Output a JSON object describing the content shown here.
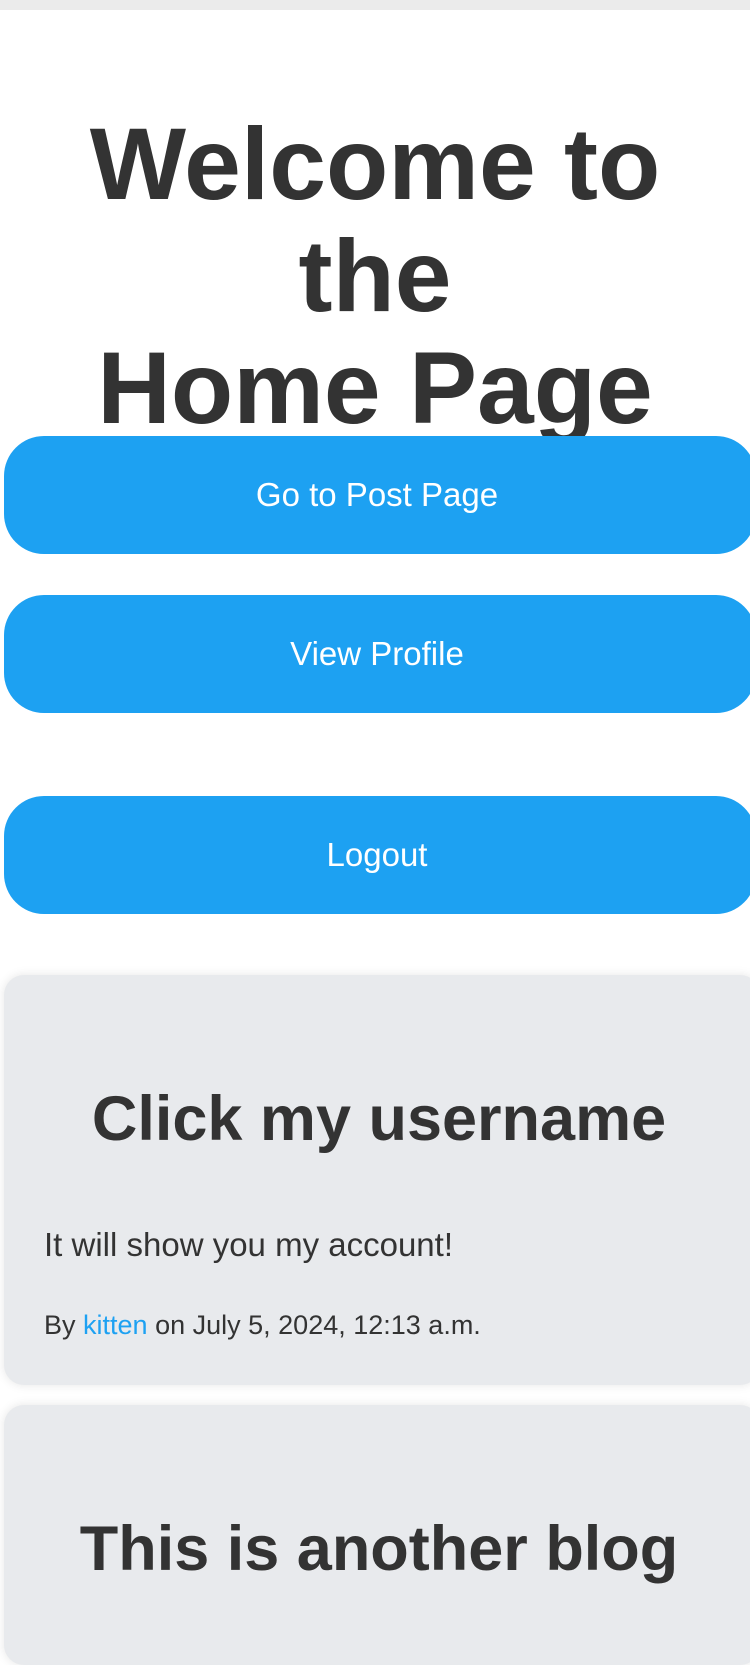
{
  "header": {
    "title_line1": "Welcome to the",
    "title_line2": "Home Page"
  },
  "actions": {
    "post_page": "Go to Post Page",
    "view_profile": "View Profile",
    "logout": "Logout"
  },
  "posts": [
    {
      "title": "Click my username",
      "body": "It will show you my account!",
      "by_label": "By",
      "author": "kitten",
      "date_text": "on July 5, 2024, 12:13 a.m."
    },
    {
      "title": "This is another blog"
    }
  ],
  "colors": {
    "accent": "#1da1f2",
    "text": "#333333",
    "card": "#e8eaed"
  }
}
